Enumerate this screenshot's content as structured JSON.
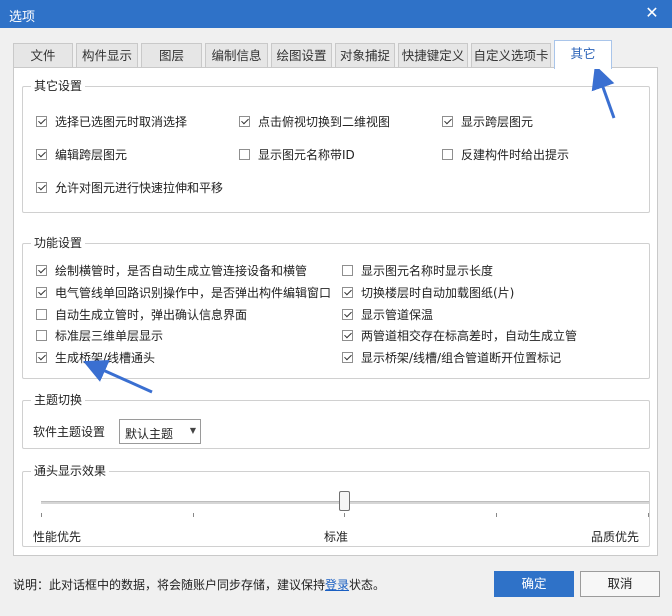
{
  "window": {
    "title": "选项",
    "close_glyph": "✕"
  },
  "tabs": [
    {
      "label": "文件",
      "active": false
    },
    {
      "label": "构件显示",
      "active": false
    },
    {
      "label": "图层",
      "active": false
    },
    {
      "label": "编制信息",
      "active": false
    },
    {
      "label": "绘图设置",
      "active": false
    },
    {
      "label": "对象捕捉",
      "active": false
    },
    {
      "label": "快捷键定义",
      "active": false
    },
    {
      "label": "自定义选项卡",
      "active": false
    },
    {
      "label": "其它",
      "active": true
    }
  ],
  "other_settings": {
    "title": "其它设置",
    "items": [
      {
        "label": "选择已选图元时取消选择",
        "checked": true
      },
      {
        "label": "点击俯视切换到二维视图",
        "checked": true
      },
      {
        "label": "显示跨层图元",
        "checked": true
      },
      {
        "label": "编辑跨层图元",
        "checked": true
      },
      {
        "label": "显示图元名称带ID",
        "checked": false
      },
      {
        "label": "反建构件时给出提示",
        "checked": false
      },
      {
        "label": "允许对图元进行快速拉伸和平移",
        "checked": true
      }
    ]
  },
  "function_settings": {
    "title": "功能设置",
    "left": [
      {
        "label": "绘制横管时，是否自动生成立管连接设备和横管",
        "checked": true
      },
      {
        "label": "电气管线单回路识别操作中，是否弹出构件编辑窗口",
        "checked": true
      },
      {
        "label": "自动生成立管时，弹出确认信息界面",
        "checked": false
      },
      {
        "label": "标准层三维单层显示",
        "checked": false
      },
      {
        "label": "生成桥架/线槽通头",
        "checked": true
      }
    ],
    "right": [
      {
        "label": "显示图元名称时显示长度",
        "checked": false
      },
      {
        "label": "切换楼层时自动加载图纸(片)",
        "checked": true
      },
      {
        "label": "显示管道保温",
        "checked": true
      },
      {
        "label": "两管道相交存在标高差时，自动生成立管",
        "checked": true
      },
      {
        "label": "显示桥架/线槽/组合管道断开位置标记",
        "checked": true
      }
    ]
  },
  "theme": {
    "title": "主题切换",
    "label": "软件主题设置",
    "selected": "默认主题"
  },
  "effect": {
    "title": "通头显示效果",
    "value_label": "标准",
    "left_label": "性能优先",
    "center_label": "标准",
    "right_label": "品质优先",
    "level": 0.5
  },
  "footer": {
    "note_prefix": "说明：此对话框中的数据，将会随账户同步存储，建议保持",
    "note_link": "登录",
    "note_suffix": "状态。",
    "ok_label": "确定",
    "cancel_label": "取消"
  },
  "colors": {
    "accent": "#2f72c8",
    "annotation_arrow": "#3a6fd1"
  }
}
